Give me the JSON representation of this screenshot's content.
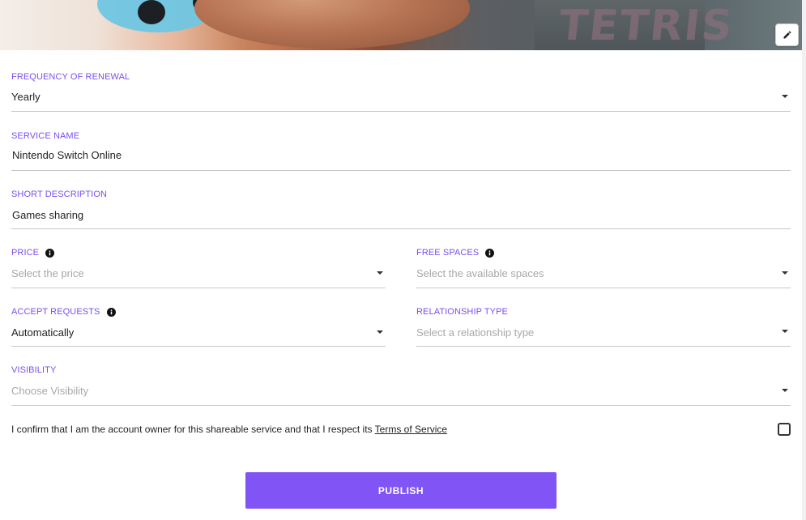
{
  "banner": {
    "artwork_text": "TETRIS",
    "edit_icon": "pencil-icon"
  },
  "form": {
    "frequency": {
      "label": "FREQUENCY OF RENEWAL",
      "value": "Yearly"
    },
    "service_name": {
      "label": "SERVICE NAME",
      "value": "Nintendo Switch Online"
    },
    "short_description": {
      "label": "SHORT DESCRIPTION",
      "value": "Games sharing"
    },
    "price": {
      "label": "PRICE",
      "placeholder": "Select the price",
      "info_icon": "info-icon"
    },
    "free_spaces": {
      "label": "FREE SPACES",
      "placeholder": "Select the available spaces",
      "info_icon": "info-icon"
    },
    "accept_requests": {
      "label": "ACCEPT REQUESTS",
      "value": "Automatically",
      "info_icon": "info-icon"
    },
    "relationship_type": {
      "label": "RELATIONSHIP TYPE",
      "placeholder": "Select a relationship type"
    },
    "visibility": {
      "label": "VISIBILITY",
      "placeholder": "Choose Visibility"
    }
  },
  "confirm": {
    "text": "I confirm that I am the account owner for this shareable service and that I respect its",
    "link": "Terms of Service",
    "checked": false
  },
  "publish_label": "PUBLISH",
  "colors": {
    "accent": "#8154f5",
    "label": "#7a4ff0",
    "placeholder": "#a8a8a8",
    "divider": "#c8c8c8"
  }
}
